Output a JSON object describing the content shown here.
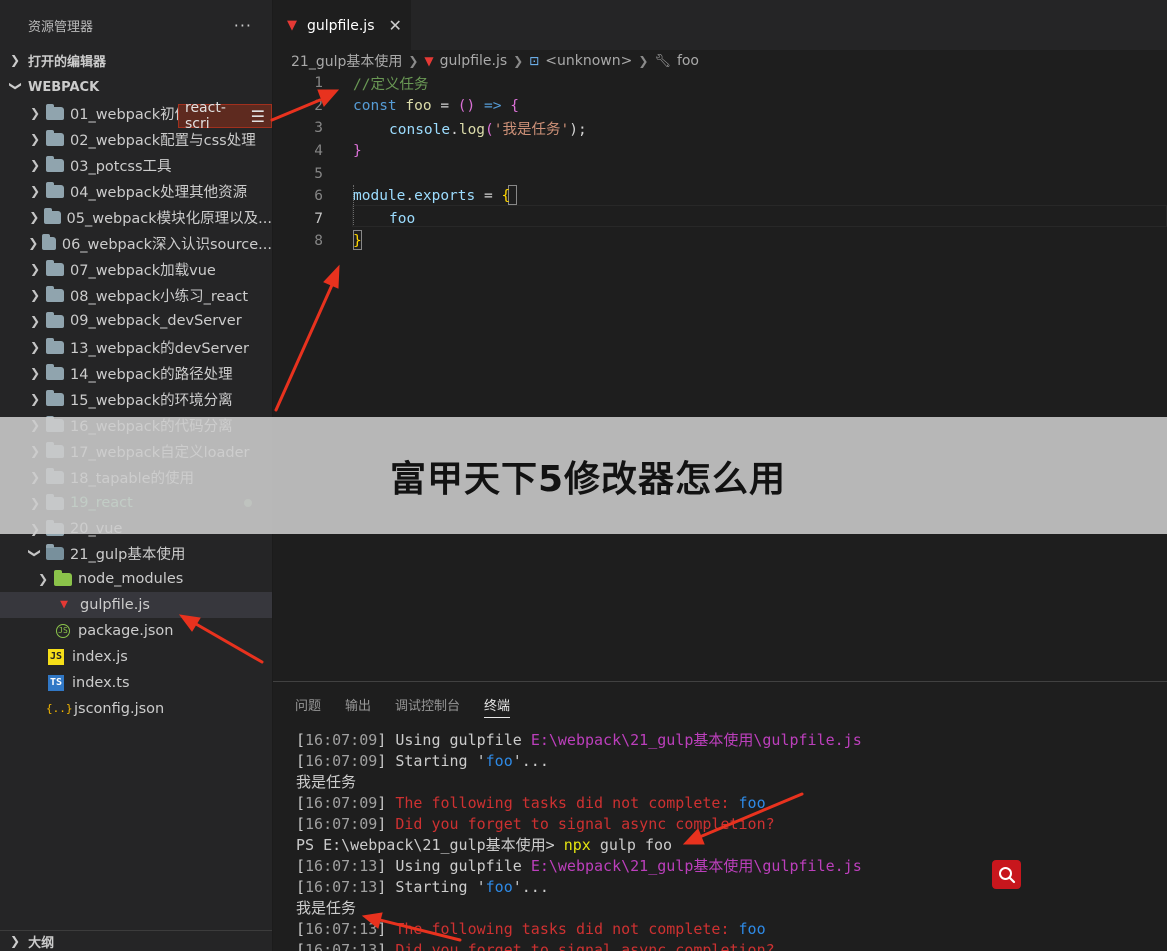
{
  "sidebar": {
    "title": "资源管理器",
    "more_label": "···",
    "open_editors": "打开的编辑器",
    "workspace": "WEBPACK",
    "folders": [
      {
        "label": "01_webpack初体验"
      },
      {
        "label": "02_webpack配置与css处理"
      },
      {
        "label": "03_potcss工具"
      },
      {
        "label": "04_webpack处理其他资源"
      },
      {
        "label": "05_webpack模块化原理以及..."
      },
      {
        "label": "06_webpack深入认识source..."
      },
      {
        "label": "07_webpack加载vue"
      },
      {
        "label": "08_webpack小练习_react"
      },
      {
        "label": "09_webpack_devServer"
      },
      {
        "label": "13_webpack的devServer"
      },
      {
        "label": "14_webpack的路径处理"
      },
      {
        "label": "15_webpack的环境分离"
      },
      {
        "label": "16_webpack的代码分离"
      },
      {
        "label": "17_webpack自定义loader"
      },
      {
        "label": "18_tapable的使用"
      },
      {
        "label": "19_react"
      },
      {
        "label": "20_vue"
      }
    ],
    "open_folder": "21_gulp基本使用",
    "open_children": {
      "node_modules": "node_modules",
      "gulpfile": "gulpfile.js",
      "package": "package.json"
    },
    "root_files": {
      "index_js": "index.js",
      "index_ts": "index.ts",
      "jsconfig": "jsconfig.json"
    },
    "js_badge": "JS",
    "ts_badge": "TS",
    "json_badge": "{..}",
    "outline": "大纲"
  },
  "tooltip": {
    "label": "react-scri"
  },
  "editor_tab": {
    "label": "gulpfile.js",
    "close": "✕"
  },
  "breadcrumb": {
    "folder": "21_gulp基本使用",
    "file": "gulpfile.js",
    "scope": "<unknown>",
    "symbol": "foo"
  },
  "code": {
    "line_numbers": [
      "1",
      "2",
      "3",
      "4",
      "5",
      "6",
      "7",
      "8"
    ],
    "l1": "//定义任务",
    "l2_kw": "const",
    "l2_name": "foo",
    "l2_eq": " = ",
    "l2_parens": "()",
    "l2_arrow": " => ",
    "l2_brace": "{",
    "l3_obj": "console",
    "l3_dot": ".",
    "l3_fn": "log",
    "l3_open": "(",
    "l3_str": "'我是任务'",
    "l3_close": ");",
    "l4": "}",
    "l6_obj": "module",
    "l6_dot": ".",
    "l6_prop": "exports",
    "l6_eq": " = ",
    "l6_brace": "{",
    "l7": "foo",
    "l8": "}"
  },
  "panel": {
    "tabs": [
      "问题",
      "输出",
      "调试控制台",
      "终端"
    ],
    "active_tab": "终端"
  },
  "terminal": {
    "lines": [
      {
        "ts": "16:07:09",
        "text": " Using gulpfile ",
        "path": "E:\\webpack\\21_gulp基本使用\\gulpfile.js"
      },
      {
        "ts": "16:07:09",
        "text": " Starting '",
        "task": "foo",
        "tail": "'..."
      },
      {
        "plain": "我是任务"
      },
      {
        "ts": "16:07:09",
        "err": " The following tasks did not complete: ",
        "task": "foo"
      },
      {
        "ts": "16:07:09",
        "err": " Did you forget to signal async completion?"
      },
      {
        "prompt": "PS E:\\webpack\\21_gulp基本使用> ",
        "cmd": "npx",
        "args": " gulp foo"
      },
      {
        "ts": "16:07:13",
        "text": " Using gulpfile ",
        "path": "E:\\webpack\\21_gulp基本使用\\gulpfile.js"
      },
      {
        "ts": "16:07:13",
        "text": " Starting '",
        "task": "foo",
        "tail": "'..."
      },
      {
        "plain": "我是任务"
      },
      {
        "ts": "16:07:13",
        "err": " The following tasks did not complete: ",
        "task": "foo"
      },
      {
        "ts": "16:07:13",
        "err": " Did you forget to signal async completion?"
      }
    ]
  },
  "overlay": {
    "title": "富甲天下5修改器怎么用"
  },
  "colors": {
    "accent_arrow": "#e8321e",
    "search_button": "#c8161d"
  }
}
